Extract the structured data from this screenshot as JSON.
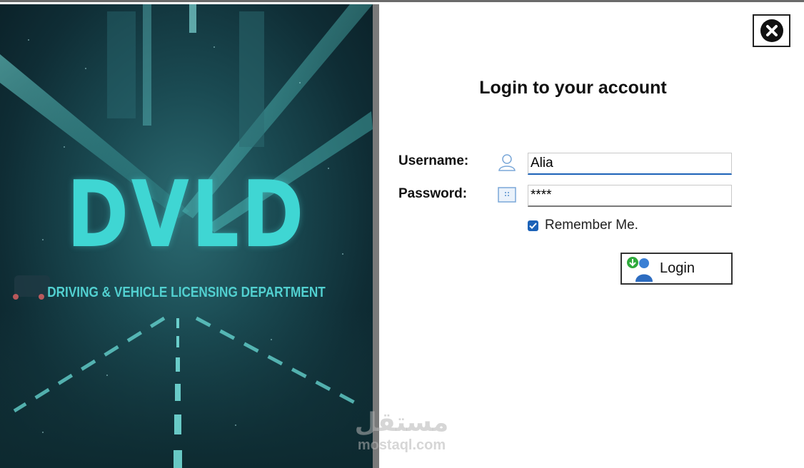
{
  "banner": {
    "logo_text": "DVLD",
    "tagline": "DRIVING & VEHICLE LICENSING DEPARTMENT"
  },
  "watermark": {
    "arabic": "مستقل",
    "latin": "mostaql.com"
  },
  "login": {
    "title": "Login to your account",
    "username_label": "Username:",
    "username_value": "Alia",
    "password_label": "Password:",
    "password_value": "****",
    "remember_label": "Remember Me.",
    "remember_checked": true,
    "login_button_label": "Login",
    "close_icon": "close-circle-x-icon",
    "username_icon": "user-icon",
    "password_icon": "keypad-icon",
    "login_icon": "users-login-icon"
  },
  "colors": {
    "accent": "#1c62b8",
    "logo": "#3fd6d3"
  }
}
